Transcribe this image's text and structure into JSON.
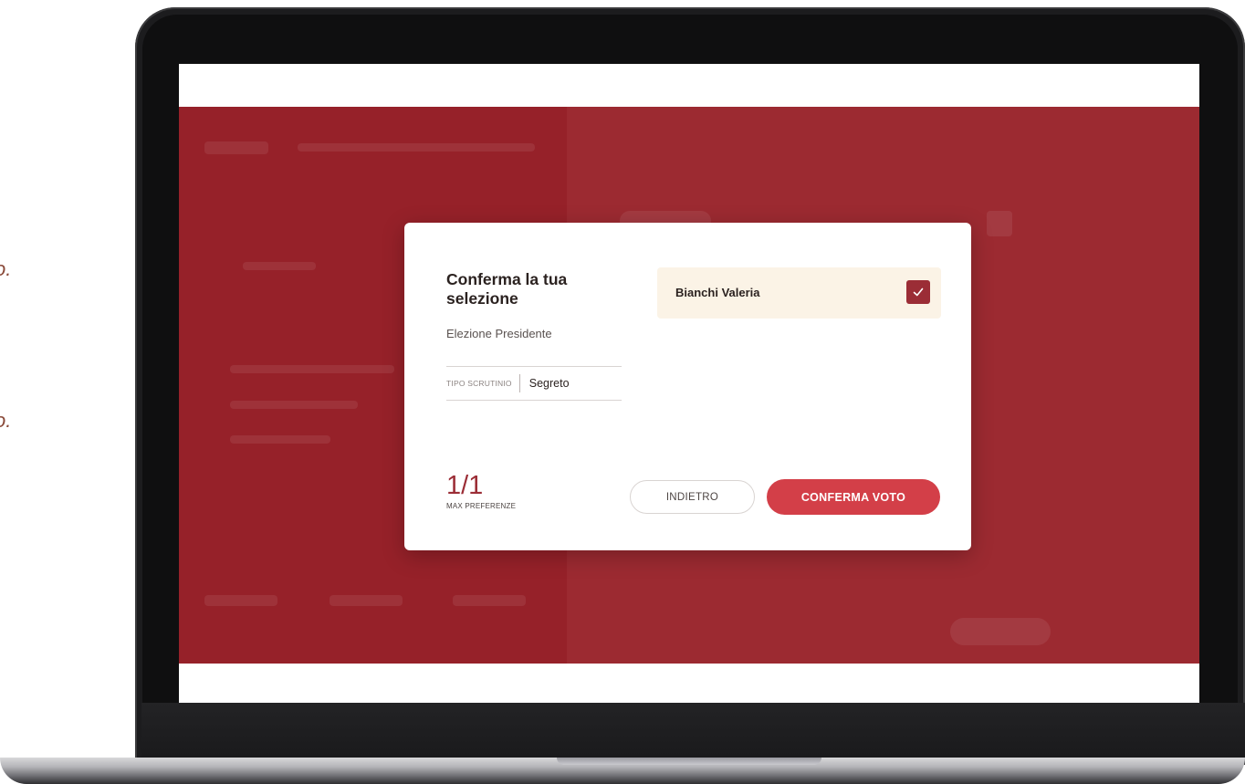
{
  "edge_marks": [
    "o.",
    "o."
  ],
  "modal": {
    "title": "Conferma la tua selezione",
    "subtitle": "Elezione Presidente",
    "scrutinio": {
      "label": "TIPO SCRUTINIO",
      "value": "Segreto"
    },
    "candidate": {
      "name": "Bianchi Valeria",
      "selected": true
    },
    "counter": {
      "value": "1/1",
      "label": "MAX PREFERENZE"
    },
    "buttons": {
      "back": "INDIETRO",
      "confirm": "CONFERMA VOTO"
    }
  },
  "colors": {
    "accent": "#9b2d36",
    "confirm_button": "#d33f48",
    "background_overlay": "#9a262e",
    "candidate_highlight": "#fbf3e6"
  }
}
